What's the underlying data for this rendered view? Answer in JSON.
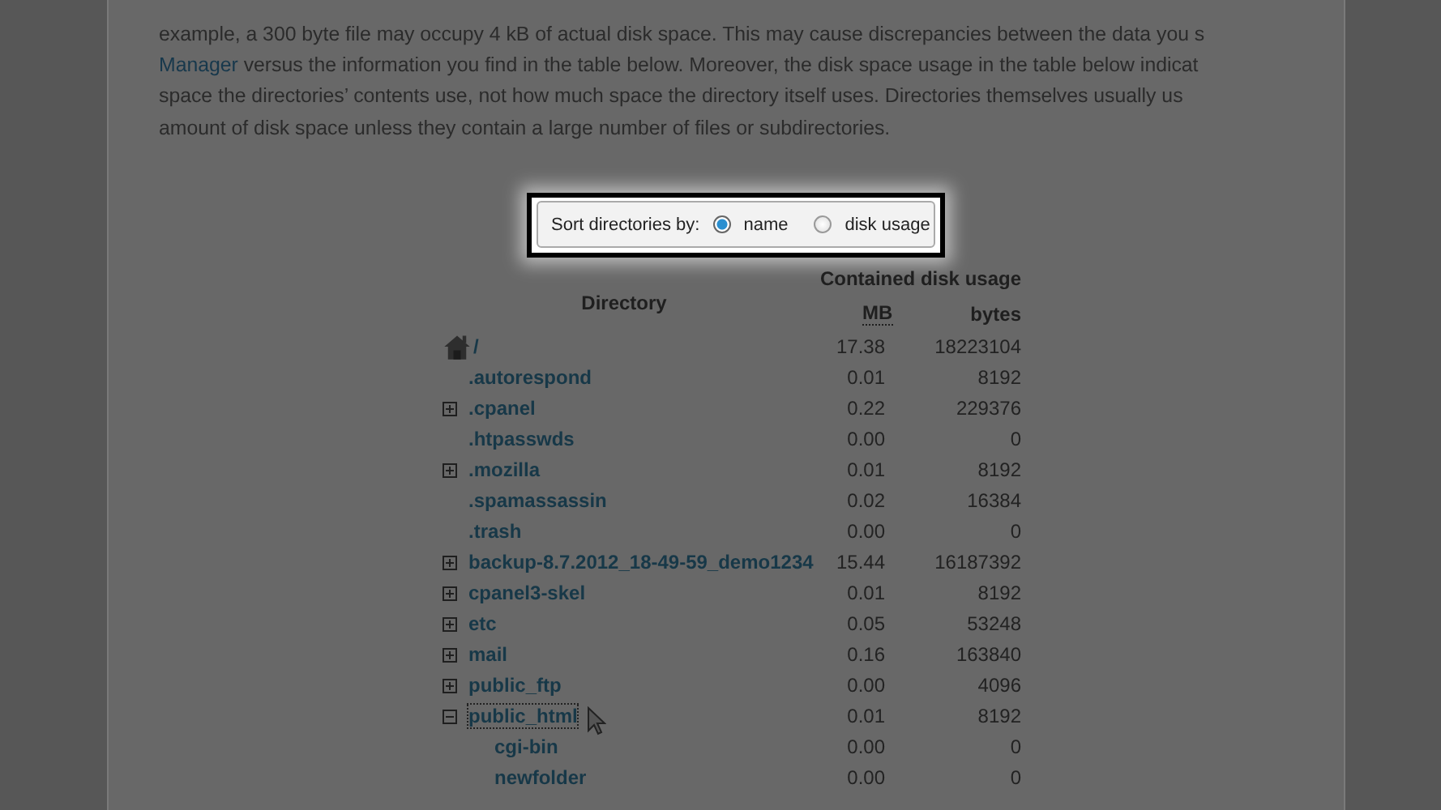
{
  "intro": {
    "lines": [
      {
        "text": "example, a 300 byte file may occupy 4 kB of actual disk space. This may cause discrepancies between the data you s"
      },
      {
        "link": "Manager",
        "text": " versus the information you find in the table below. Moreover, the disk space usage in the table below indicat"
      },
      {
        "text": "space the directories’ contents use, not how much space the directory itself uses. Directories themselves usually us"
      },
      {
        "text": "amount of disk space unless they contain a large number of files or subdirectories."
      }
    ]
  },
  "sort": {
    "label": "Sort directories by:",
    "options": [
      {
        "label": "name",
        "selected": true
      },
      {
        "label": "disk usage",
        "selected": false
      }
    ]
  },
  "table": {
    "directory_header": "Directory",
    "usage_header": "Contained disk usage",
    "mb_header": "MB",
    "bytes_header": "bytes",
    "root": {
      "name": "/",
      "mb": "17.38",
      "bytes": "18223104"
    },
    "rows": [
      {
        "kind": "plain",
        "name": ".autorespond",
        "mb": "0.01",
        "bytes": "8192",
        "selected": false
      },
      {
        "kind": "expandable",
        "name": ".cpanel",
        "mb": "0.22",
        "bytes": "229376",
        "expanded": false,
        "selected": false
      },
      {
        "kind": "plain",
        "name": ".htpasswds",
        "mb": "0.00",
        "bytes": "0",
        "selected": false
      },
      {
        "kind": "expandable",
        "name": ".mozilla",
        "mb": "0.01",
        "bytes": "8192",
        "expanded": false,
        "selected": false
      },
      {
        "kind": "plain",
        "name": ".spamassassin",
        "mb": "0.02",
        "bytes": "16384",
        "selected": false
      },
      {
        "kind": "plain",
        "name": ".trash",
        "mb": "0.00",
        "bytes": "0",
        "selected": false
      },
      {
        "kind": "expandable",
        "name": "backup-8.7.2012_18-49-59_demo1234",
        "mb": "15.44",
        "bytes": "16187392",
        "expanded": false,
        "selected": false
      },
      {
        "kind": "expandable",
        "name": "cpanel3-skel",
        "mb": "0.01",
        "bytes": "8192",
        "expanded": false,
        "selected": false
      },
      {
        "kind": "expandable",
        "name": "etc",
        "mb": "0.05",
        "bytes": "53248",
        "expanded": false,
        "selected": false
      },
      {
        "kind": "expandable",
        "name": "mail",
        "mb": "0.16",
        "bytes": "163840",
        "expanded": false,
        "selected": false
      },
      {
        "kind": "expandable",
        "name": "public_ftp",
        "mb": "0.00",
        "bytes": "4096",
        "expanded": false,
        "selected": false
      },
      {
        "kind": "expandable",
        "name": "public_html",
        "mb": "0.01",
        "bytes": "8192",
        "expanded": true,
        "selected": true,
        "children": [
          {
            "kind": "plain",
            "name": "cgi-bin",
            "mb": "0.00",
            "bytes": "0",
            "selected": false
          },
          {
            "kind": "plain",
            "name": "newfolder",
            "mb": "0.00",
            "bytes": "0",
            "selected": false
          }
        ]
      }
    ]
  }
}
